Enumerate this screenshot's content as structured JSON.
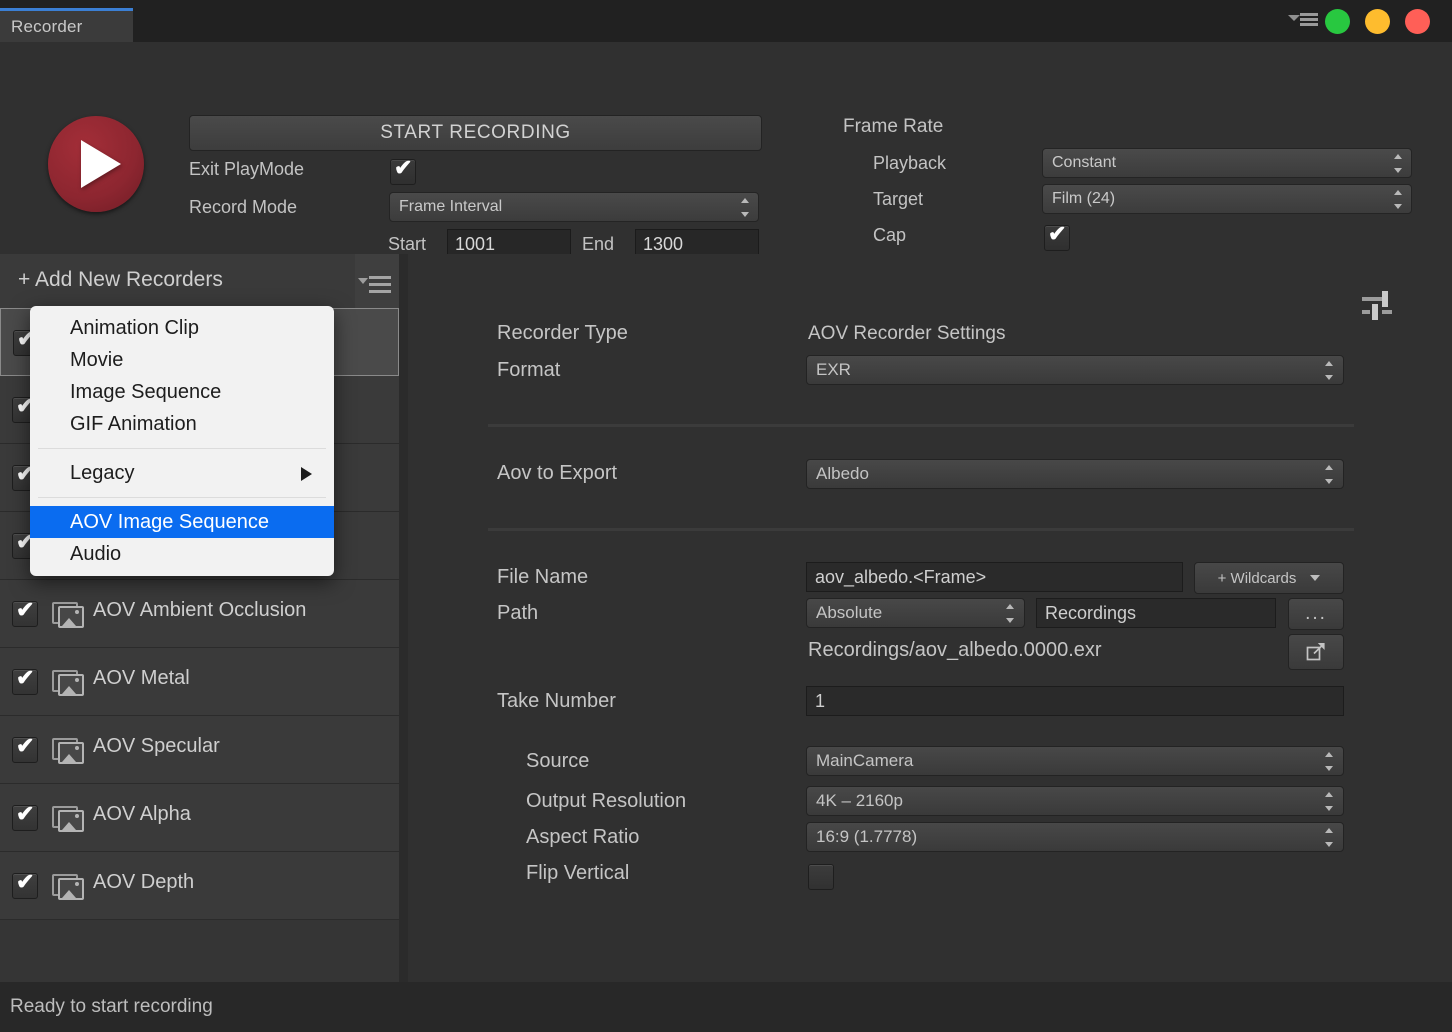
{
  "window": {
    "tab_label": "Recorder",
    "controls": {
      "menu_icon": "hamburger-icon",
      "green": "#28c840",
      "amber": "#febc2e",
      "red": "#ff5f57"
    }
  },
  "header": {
    "record_button_icon": "play-icon",
    "start_recording_label": "START RECORDING",
    "exit_playmode_label": "Exit PlayMode",
    "exit_playmode_checked": "✔",
    "record_mode_label": "Record Mode",
    "record_mode_value": "Frame Interval",
    "start_label": "Start",
    "start_value": "1001",
    "end_label": "End",
    "end_value": "1300",
    "frame_rate_label": "Frame Rate",
    "playback_label": "Playback",
    "playback_value": "Constant",
    "target_label": "Target",
    "target_value": "Film (24)",
    "cap_label": "Cap",
    "cap_checked": "✔"
  },
  "recorder_list": {
    "add_label": "+ Add New Recorders",
    "list_menu_icon": "list-options-icon",
    "items": [
      {
        "label": "",
        "checked": "✔",
        "selected": true
      },
      {
        "label": "",
        "checked": "✔",
        "selected": false
      },
      {
        "label": "",
        "checked": "✔",
        "selected": false
      },
      {
        "label": "",
        "checked": "✔",
        "selected": false
      },
      {
        "label": "AOV Ambient Occlusion",
        "checked": "✔",
        "selected": false
      },
      {
        "label": "AOV Metal",
        "checked": "✔",
        "selected": false
      },
      {
        "label": "AOV Specular",
        "checked": "✔",
        "selected": false
      },
      {
        "label": "AOV Alpha",
        "checked": "✔",
        "selected": false
      },
      {
        "label": "AOV Depth",
        "checked": "✔",
        "selected": false
      }
    ]
  },
  "add_menu": {
    "items": [
      {
        "label": "Animation Clip",
        "highlighted": false,
        "submenu": false
      },
      {
        "label": "Movie",
        "highlighted": false,
        "submenu": false
      },
      {
        "label": "Image Sequence",
        "highlighted": false,
        "submenu": false
      },
      {
        "label": "GIF Animation",
        "highlighted": false,
        "submenu": false
      },
      {
        "label": "Legacy",
        "highlighted": false,
        "submenu": true
      },
      {
        "label": "AOV Image Sequence",
        "highlighted": true,
        "submenu": false
      },
      {
        "label": "Audio",
        "highlighted": false,
        "submenu": false
      }
    ]
  },
  "settings": {
    "panel_icon": "sliders-icon",
    "recorder_type_label": "Recorder Type",
    "recorder_type_value": "AOV Recorder Settings",
    "format_label": "Format",
    "format_value": "EXR",
    "aov_label": "Aov to Export",
    "aov_value": "Albedo",
    "file_name_label": "File Name",
    "file_name_value": "aov_albedo.<Frame>",
    "wildcards_label": "+ Wildcards",
    "path_label": "Path",
    "path_mode_value": "Absolute",
    "path_value": "Recordings",
    "browse_label": "...",
    "open_icon": "external-link-icon",
    "resolved_path": "Recordings/aov_albedo.0000.exr",
    "take_number_label": "Take Number",
    "take_number_value": "1",
    "source_label": "Source",
    "source_value": "MainCamera",
    "output_resolution_label": "Output Resolution",
    "output_resolution_value": "4K – 2160p",
    "aspect_ratio_label": "Aspect Ratio",
    "aspect_ratio_value": "16:9 (1.7778)",
    "flip_vertical_label": "Flip Vertical",
    "flip_vertical_checked": false
  },
  "status": {
    "text": "Ready to start recording"
  }
}
